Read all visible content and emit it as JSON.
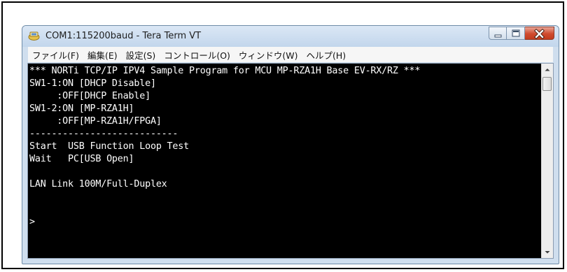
{
  "window": {
    "title": "COM1:115200baud - Tera Term VT"
  },
  "menu": [
    {
      "label": "ファイル(F)"
    },
    {
      "label": "編集(E)"
    },
    {
      "label": "設定(S)"
    },
    {
      "label": "コントロール(O)"
    },
    {
      "label": "ウィンドウ(W)"
    },
    {
      "label": "ヘルプ(H)"
    }
  ],
  "terminal": {
    "lines": [
      "*** NORTi TCP/IP IPV4 Sample Program for MCU MP-RZA1H Base EV-RX/RZ ***",
      "SW1-1:ON [DHCP Disable]",
      "     :OFF[DHCP Enable]",
      "SW1-2:ON [MP-RZA1H]",
      "     :OFF[MP-RZA1H/FPGA]",
      "---------------------------",
      "Start  USB Function Loop Test",
      "Wait   PC[USB Open]",
      "",
      "LAN Link 100M/Full-Duplex",
      "",
      "",
      ">"
    ]
  },
  "colors": {
    "terminal_bg": "#000000",
    "terminal_fg": "#ffffff",
    "close_button": "#c9452a"
  }
}
